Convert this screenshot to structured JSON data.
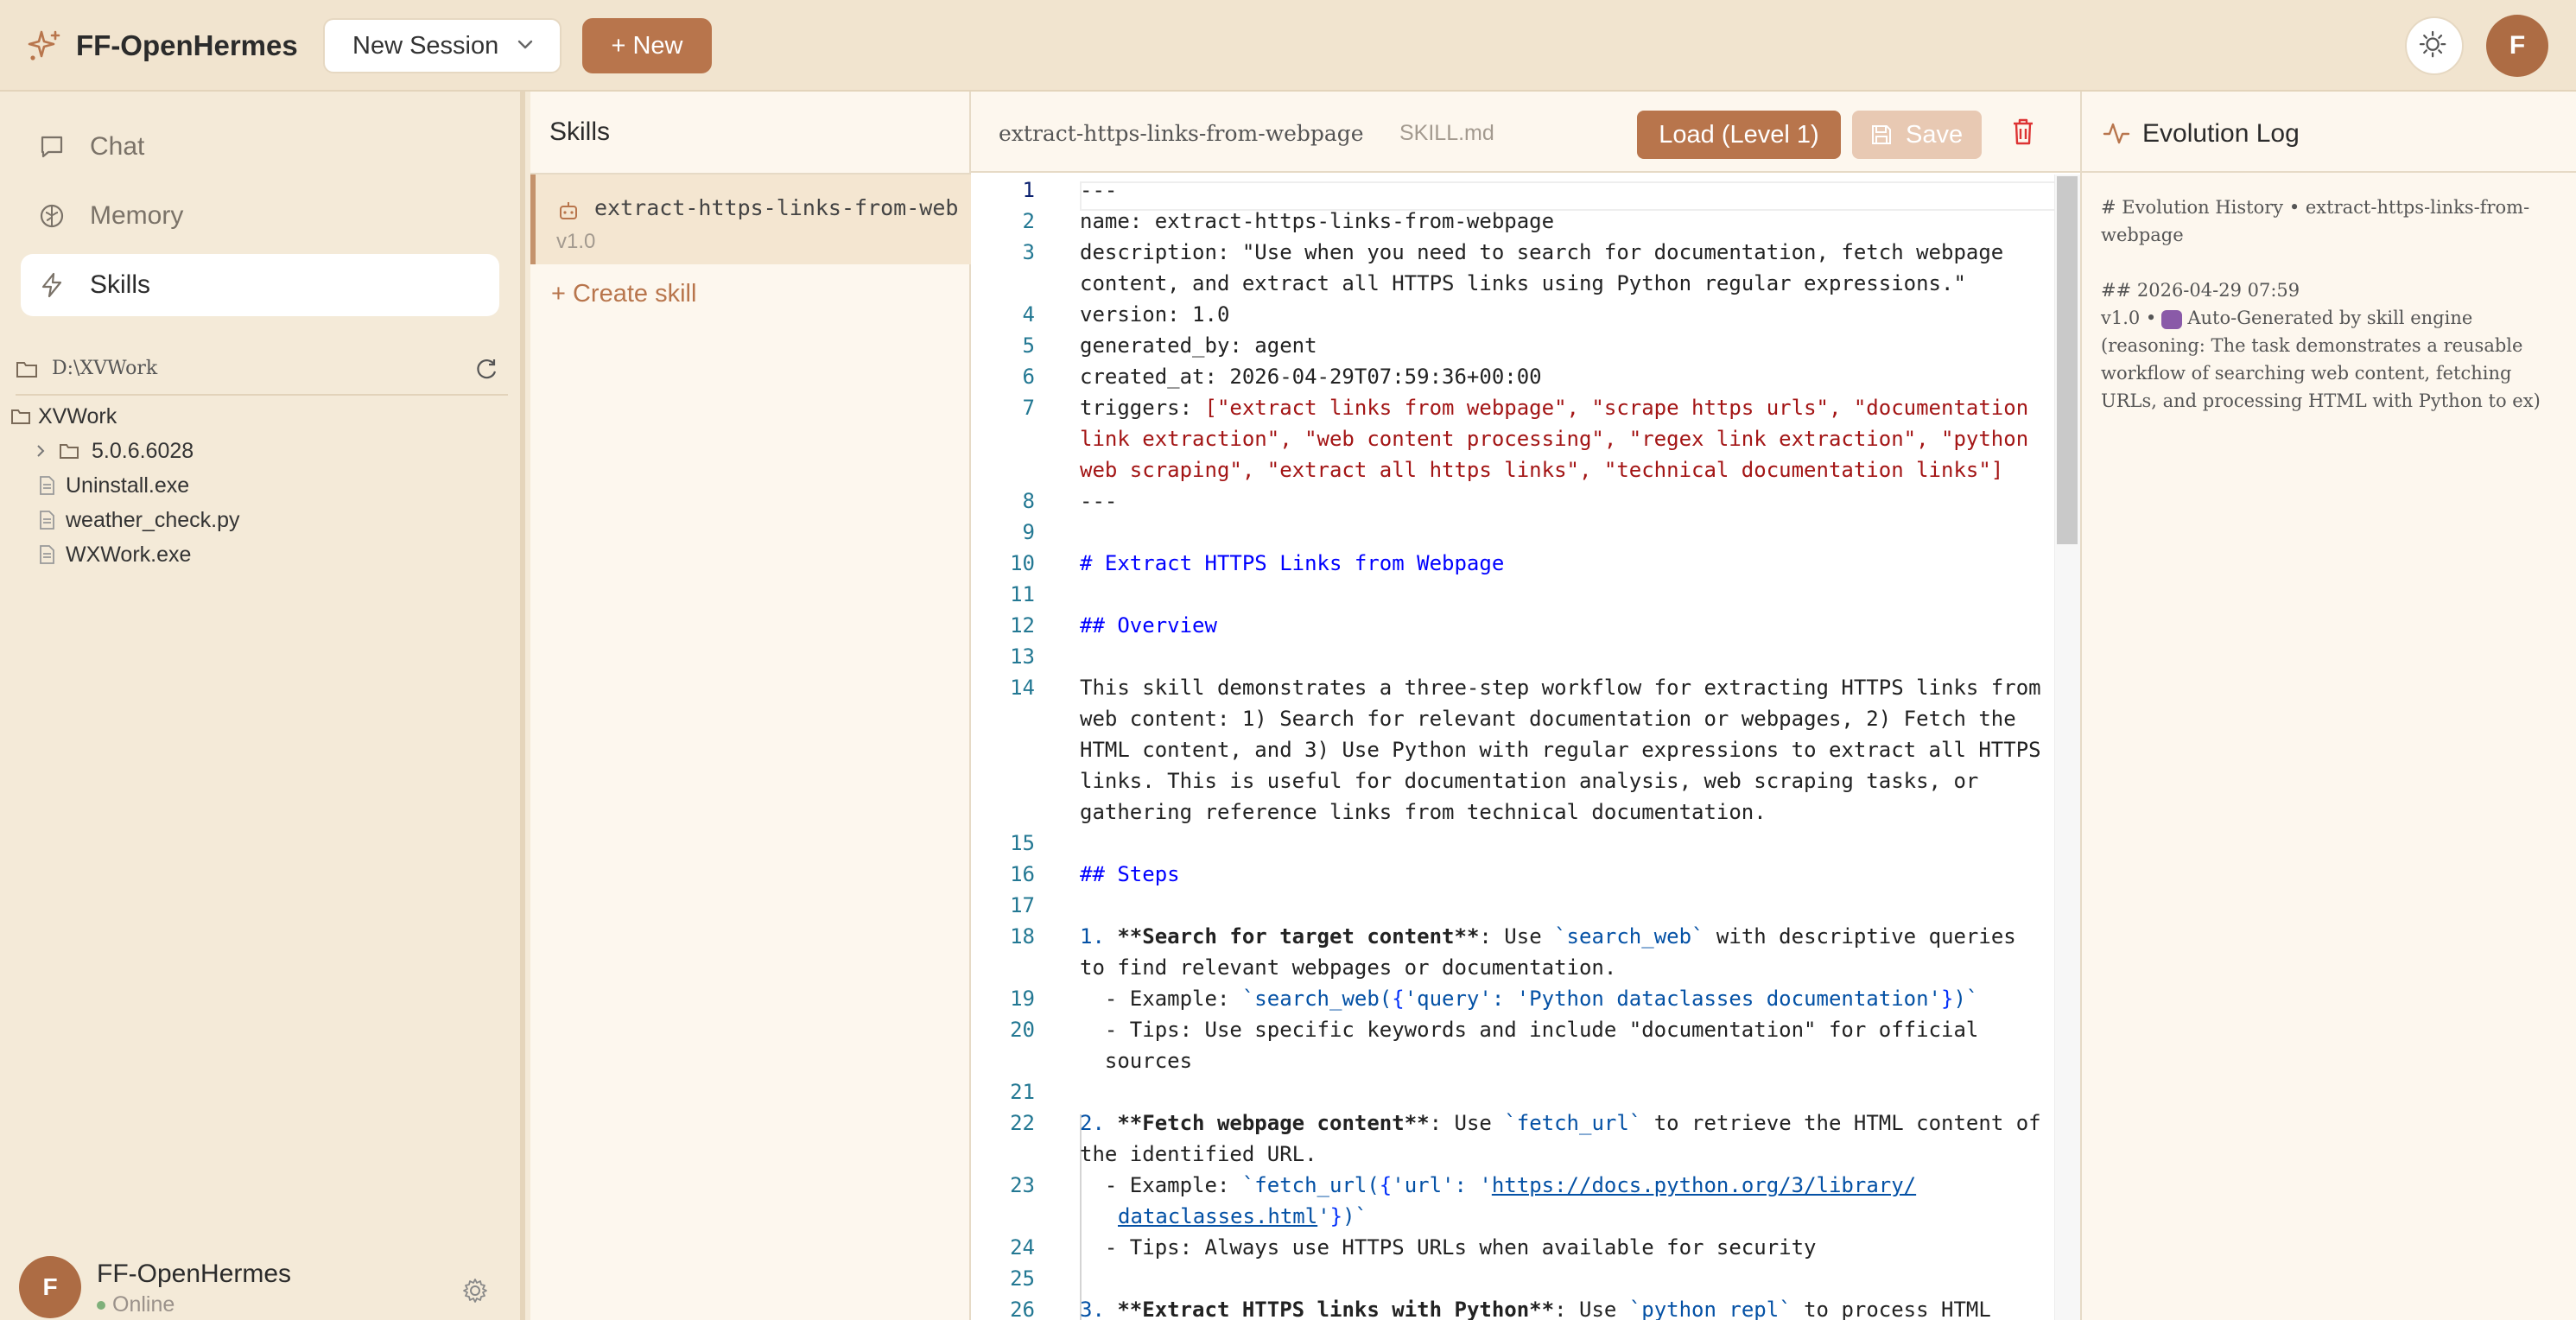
{
  "app": {
    "title": "FF-OpenHermes",
    "accent": "#b8754c"
  },
  "header": {
    "session_label": "New Session",
    "new_button": "+ New",
    "avatar_initial": "F"
  },
  "sidebar": {
    "nav": [
      {
        "label": "Chat",
        "icon": "chat-icon",
        "active": false
      },
      {
        "label": "Memory",
        "icon": "brain-icon",
        "active": false
      },
      {
        "label": "Skills",
        "icon": "lightning-icon",
        "active": true
      }
    ],
    "path": "D:\\XVWork",
    "tree": {
      "root": "XVWork",
      "items": [
        {
          "label": "5.0.6.6028",
          "type": "folder"
        },
        {
          "label": "Uninstall.exe",
          "type": "file"
        },
        {
          "label": "weather_check.py",
          "type": "file"
        },
        {
          "label": "WXWork.exe",
          "type": "file"
        }
      ]
    },
    "user": {
      "initial": "F",
      "name": "FF-OpenHermes",
      "status": "Online"
    }
  },
  "skills": {
    "title": "Skills",
    "items": [
      {
        "name": "extract-https-links-from-webpage",
        "version": "v1.0"
      }
    ],
    "create_label": "+ Create skill"
  },
  "editor": {
    "file_title": "extract-https-links-from-webpage",
    "file_sub": "SKILL.md",
    "load_label": "Load (Level 1)",
    "save_label": "Save",
    "line_numbers": [
      "1",
      "2",
      "3",
      "",
      "4",
      "5",
      "6",
      "7",
      "",
      "",
      "8",
      "9",
      "10",
      "11",
      "12",
      "13",
      "14",
      "",
      "",
      "",
      "",
      "15",
      "16",
      "17",
      "18",
      "",
      "19",
      "20",
      "",
      "21",
      "22",
      "",
      "23",
      "",
      "24",
      "25",
      "26"
    ],
    "lines": [
      "---",
      "name: extract-https-links-from-webpage",
      "description: \"Use when you need to search for documentation, fetch webpage",
      "content, and extract all HTTPS links using Python regular expressions.\"",
      "version: 1.0",
      "generated_by: agent",
      "created_at: 2026-04-29T07:59:36+00:00",
      "triggers: ",
      "[\"extract links from webpage\", \"scrape https urls\", \"documentation",
      "link extraction\", \"web content processing\", \"regex link extraction\", \"python",
      "web scraping\", \"extract all https links\", \"technical documentation links\"]",
      "---",
      "",
      "# Extract HTTPS Links from Webpage",
      "",
      "## Overview",
      "",
      "This skill demonstrates a three-step workflow for extracting HTTPS links from",
      "web content: 1",
      ") Search for relevant documentation or webpages, 2",
      ") Fetch the",
      "HTML content, and 3",
      ") Use Python with regular expressions to extract all HTTPS",
      "links. This is useful for documentation analysis, web scraping tasks, or",
      "gathering reference links from technical documentation.",
      "",
      "## Steps",
      "",
      "1. ",
      "**Search for target content**",
      ": Use ",
      "`search_web`",
      " with descriptive queries",
      "to find relevant webpages or documentation.",
      "  - Example: ",
      "`search_web(",
      "{",
      "'query': 'Python dataclasses documentation'",
      "}",
      ")`",
      "  - Tips: Use specific keywords and include \"documentation\" for official",
      "  sources",
      "",
      "2. ",
      "**Fetch webpage content**",
      ": Use ",
      "`fetch_url`",
      " to retrieve the HTML content of",
      "the identified URL.",
      "  - Example: ",
      "`fetch_url(",
      "{",
      "'url': '",
      "https://docs.python.org/3/library/",
      "dataclasses.html",
      "'",
      "}",
      ")`",
      "  - Tips: Always use HTTPS URLs when available for security",
      "",
      "3. ",
      "**Extract HTTPS links with Python**",
      ": Use ",
      "`python_repl`",
      " to process HTML"
    ]
  },
  "evolution": {
    "title": "Evolution Log",
    "heading": "# Evolution History • extract-https-links-from-webpage",
    "entry_date": "## 2026-04-29 07:59",
    "entry_prefix": "v1.0 •",
    "entry_text": "Auto-Generated by skill engine (reasoning: The task demonstrates a reusable workflow of searching web content, fetching URLs, and processing HTML with Python to ex)"
  }
}
